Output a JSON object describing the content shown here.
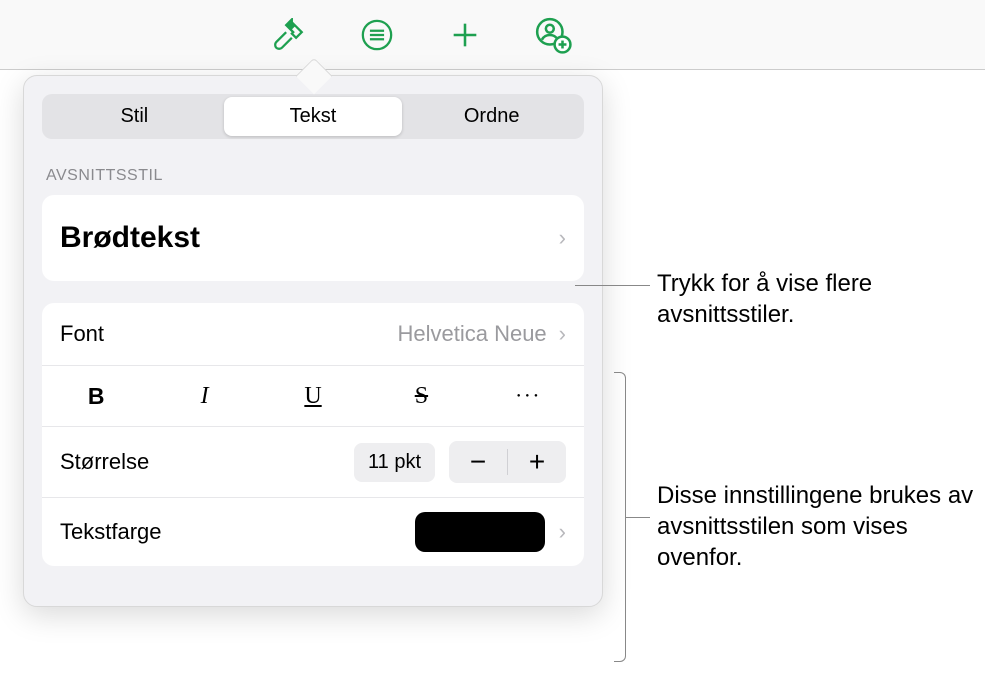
{
  "tabs": {
    "stil": "Stil",
    "tekst": "Tekst",
    "ordne": "Ordne"
  },
  "sections": {
    "avsnittsstil": "AVSNITTSSTIL"
  },
  "paragraph_style": "Brødtekst",
  "font_label": "Font",
  "font_value": "Helvetica Neue",
  "format": {
    "bold": "B",
    "italic": "I",
    "underline": "U",
    "strike": "S",
    "more": "●●●"
  },
  "size_label": "Størrelse",
  "size_value": "11 pkt",
  "stepper": {
    "minus": "−",
    "plus": "+"
  },
  "textcolor_label": "Tekstfarge",
  "chevron": "›",
  "annotations": {
    "styles": "Trykk for å vise flere avsnittsstiler.",
    "settings": "Disse innstillingene brukes av avsnittsstilen som vises ovenfor."
  }
}
